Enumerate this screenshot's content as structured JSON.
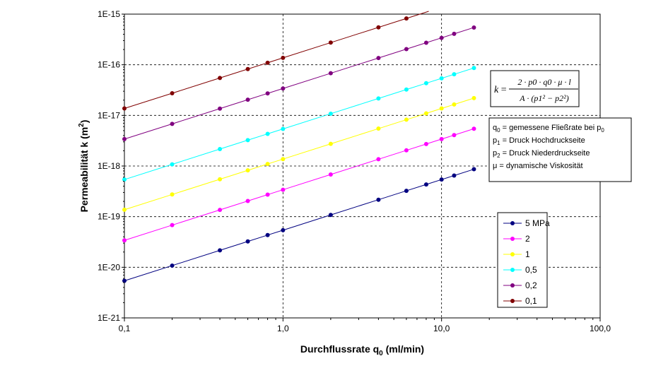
{
  "chart_data": {
    "type": "line",
    "xscale": "log",
    "yscale": "log",
    "xlim": [
      0.1,
      100
    ],
    "ylim": [
      1e-21,
      1e-15
    ],
    "grid": true,
    "legend_position": "right",
    "xlabel": "Durchflussrate q0 (ml/min)",
    "ylabel": "Permeabilität k (m2)",
    "x_tick_labels": [
      "0,1",
      "1,0",
      "10,0",
      "100,0"
    ],
    "x_tick_values": [
      0.1,
      1,
      10,
      100
    ],
    "y_tick_labels": [
      "1E-21",
      "1E-20",
      "1E-19",
      "1E-18",
      "1E-17",
      "1E-16",
      "1E-15"
    ],
    "y_tick_values": [
      1e-21,
      1e-20,
      1e-19,
      1e-18,
      1e-17,
      1e-16,
      1e-15
    ],
    "x": [
      0.1,
      0.2,
      0.4,
      0.6,
      0.8,
      1.0,
      2.0,
      4.0,
      6.0,
      8.0,
      10.0,
      12.0,
      16.0
    ],
    "series": [
      {
        "name": "5 MPa",
        "color": "#000080",
        "values": [
          5.4e-21,
          1.08e-20,
          2.16e-20,
          3.24e-20,
          4.32e-20,
          5.4e-20,
          1.08e-19,
          2.16e-19,
          3.24e-19,
          4.32e-19,
          5.4e-19,
          6.48e-19,
          8.64e-19
        ]
      },
      {
        "name": "2",
        "color": "#ff00ff",
        "values": [
          3.4e-20,
          6.8e-20,
          1.36e-19,
          2.04e-19,
          2.72e-19,
          3.4e-19,
          6.8e-19,
          1.36e-18,
          2.04e-18,
          2.72e-18,
          3.4e-18,
          4.08e-18,
          5.44e-18
        ]
      },
      {
        "name": "1",
        "color": "#ffff00",
        "values": [
          1.37e-19,
          2.74e-19,
          5.48e-19,
          8.22e-19,
          1.096e-18,
          1.37e-18,
          2.74e-18,
          5.48e-18,
          8.22e-18,
          1.096e-17,
          1.37e-17,
          1.644e-17,
          2.192e-17
        ]
      },
      {
        "name": "0,5",
        "color": "#00ffff",
        "values": [
          5.4e-19,
          1.08e-18,
          2.16e-18,
          3.24e-18,
          4.32e-18,
          5.4e-18,
          1.08e-17,
          2.16e-17,
          3.24e-17,
          4.32e-17,
          5.4e-17,
          6.48e-17,
          8.64e-17
        ]
      },
      {
        "name": "0,2",
        "color": "#800080",
        "values": [
          3.4e-18,
          6.8e-18,
          1.36e-17,
          2.04e-17,
          2.72e-17,
          3.4e-17,
          6.8e-17,
          1.36e-16,
          2.04e-16,
          2.72e-16,
          3.4e-16,
          4.08e-16,
          5.44e-16
        ]
      },
      {
        "name": "0,1",
        "color": "#800000",
        "values": [
          1.37e-17,
          2.74e-17,
          5.48e-17,
          8.22e-17,
          1.096e-16,
          1.37e-16,
          2.74e-16,
          5.48e-16,
          8.22e-16,
          null,
          null,
          null,
          null
        ],
        "line_end": [
          8.3,
          1.138e-15
        ]
      }
    ],
    "annotations": {
      "formula": {
        "lhs": "k",
        "numerator": "2 · p0 · q0 · μ · l",
        "denominator": "A · (p1² − p2²)"
      },
      "definitions": [
        {
          "sym": "q",
          "sub": "0",
          "text": " = gemessene Fließrate bei p",
          "tail_sub": "0"
        },
        {
          "sym": "p",
          "sub": "1",
          "text": " = Druck Hochdruckseite",
          "tail_sub": ""
        },
        {
          "sym": "p",
          "sub": "2",
          "text": " = Druck Niederdruckseite",
          "tail_sub": ""
        },
        {
          "sym": "μ",
          "sub": "",
          "text": " = dynamische Viskosität",
          "tail_sub": ""
        }
      ]
    }
  }
}
